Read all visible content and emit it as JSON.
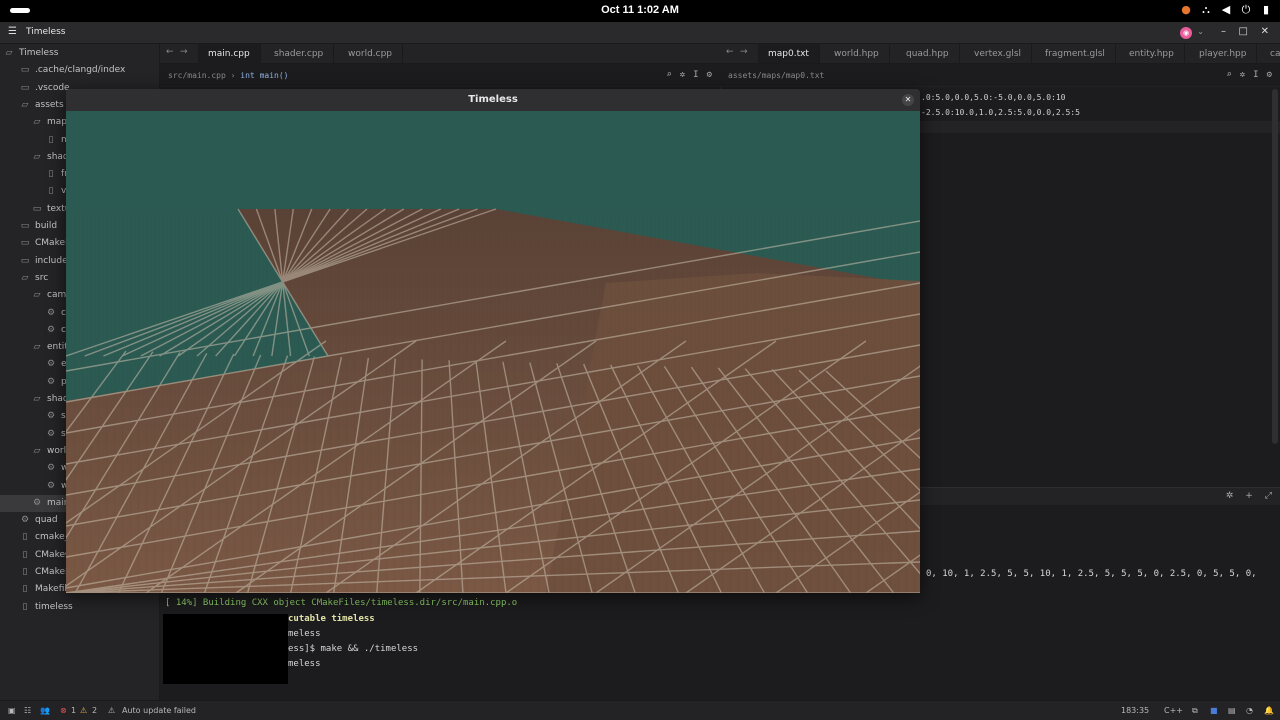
{
  "topbar": {
    "clock": "Oct 11   1:02 AM",
    "icons": [
      "microphone-icon",
      "network-icon",
      "volume-icon",
      "power-icon",
      "battery-icon"
    ]
  },
  "window": {
    "title": "Timeless"
  },
  "sidebar": {
    "items": [
      {
        "label": "Timeless",
        "icon": "folder-open"
      },
      {
        "label": ".cache/clangd/index",
        "icon": "folder"
      },
      {
        "label": ".vscode",
        "icon": "folder"
      },
      {
        "label": "assets",
        "icon": "folder-open"
      },
      {
        "label": "map",
        "icon": "folder-open"
      },
      {
        "label": "m",
        "icon": "file"
      },
      {
        "label": "shad",
        "icon": "folder-open"
      },
      {
        "label": "fr",
        "icon": "file"
      },
      {
        "label": "ve",
        "icon": "file"
      },
      {
        "label": "textu",
        "icon": "folder"
      },
      {
        "label": "build",
        "icon": "folder"
      },
      {
        "label": "CMakeF",
        "icon": "folder"
      },
      {
        "label": "include",
        "icon": "folder"
      },
      {
        "label": "src",
        "icon": "folder-open"
      },
      {
        "label": "came",
        "icon": "folder-open"
      },
      {
        "label": "ca",
        "icon": "cpp"
      },
      {
        "label": "ca",
        "icon": "cpp"
      },
      {
        "label": "entiti",
        "icon": "folder-open"
      },
      {
        "label": "e",
        "icon": "cpp"
      },
      {
        "label": "p",
        "icon": "cpp"
      },
      {
        "label": "shad",
        "icon": "folder-open"
      },
      {
        "label": "sl",
        "icon": "cpp"
      },
      {
        "label": "sl",
        "icon": "cpp"
      },
      {
        "label": "worl",
        "icon": "folder-open"
      },
      {
        "label": "w",
        "icon": "cpp"
      },
      {
        "label": "w",
        "icon": "cpp"
      },
      {
        "label": "main",
        "icon": "cpp"
      },
      {
        "label": "quad",
        "icon": "cpp"
      },
      {
        "label": "cmake_",
        "icon": "file"
      },
      {
        "label": "CMakeC",
        "icon": "file"
      },
      {
        "label": "CMakeL",
        "icon": "file"
      },
      {
        "label": "Makefile",
        "icon": "file"
      },
      {
        "label": "timeless",
        "icon": "file"
      }
    ]
  },
  "left_pane": {
    "tabs": [
      "main.cpp",
      "shader.cpp",
      "world.cpp"
    ],
    "breadcrumb_path": "src/main.cpp",
    "breadcrumb_sep": "›",
    "breadcrumb_kw": "int",
    "breadcrumb_fn": "main()"
  },
  "right_pane": {
    "tabs": [
      "map0.txt",
      "world.hpp",
      "quad.hpp",
      "vertex.glsl",
      "fragment.glsl",
      "entity.hpp",
      "player.hpp",
      "ca"
    ],
    "breadcrumb_path": "assets/maps/map0.txt",
    "lines": [
      ".0:5.0,0.0,5.0:-5.0,0.0,5.0:10",
      "-2.5.0:10.0,1.0,2.5:5.0,0.0,2.5:5"
    ]
  },
  "terminal": {
    "right_line": "0, 10, 1, 2.5, 5, 5, 10, 1, 2.5, 5, 5, 5, 0, 2.5, 0, 5, 5, 0,",
    "lines": [
      {
        "text": "[ 14%] Building CXX object CMakeFiles/timeless.dir/src/main.cpp.o",
        "style": "green"
      },
      {
        "text": "cutable timeless",
        "style": "bold"
      },
      {
        "text": "meless",
        "style": "normal"
      },
      {
        "text": "ess]$ make && ./timeless",
        "style": "normal"
      },
      {
        "text": "meless",
        "style": "normal"
      }
    ]
  },
  "statusbar": {
    "errors": "1",
    "warnings": "2",
    "message": "Auto update failed",
    "cursor": "183:35",
    "language": "C++"
  },
  "game_window": {
    "title": "Timeless",
    "sky_color": "#2a5a52",
    "floor_color": "#6a4a38"
  }
}
